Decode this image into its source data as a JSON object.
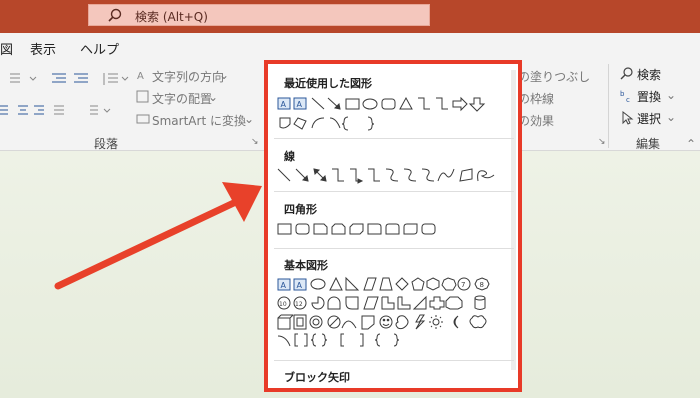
{
  "titlebar": {
    "search_text": "検索 (Alt+Q)"
  },
  "menu": {
    "items": [
      "図",
      "表示",
      "ヘルプ"
    ]
  },
  "ribbon": {
    "text_direction": "文字列の方向",
    "text_align": "文字の配置",
    "smartart": "SmartArt に変換",
    "paragraph_group": "段落",
    "shape_fill": "形の塗りつぶし",
    "shape_outline": "形の枠線",
    "shape_effects": "形の効果",
    "find": "検索",
    "replace": "置換",
    "select": "選択",
    "editing_group": "編集"
  },
  "shapes_panel": {
    "sections": [
      {
        "title": "最近使用した図形"
      },
      {
        "title": "線"
      },
      {
        "title": "四角形"
      },
      {
        "title": "基本図形"
      },
      {
        "title": "ブロック矢印"
      }
    ]
  },
  "colors": {
    "title_bar": "#b7472a",
    "highlight_border": "#e83a28",
    "arrow": "#e8412a",
    "shape_stroke": "#3a3a3a",
    "icon_blue": "#2b579a"
  }
}
